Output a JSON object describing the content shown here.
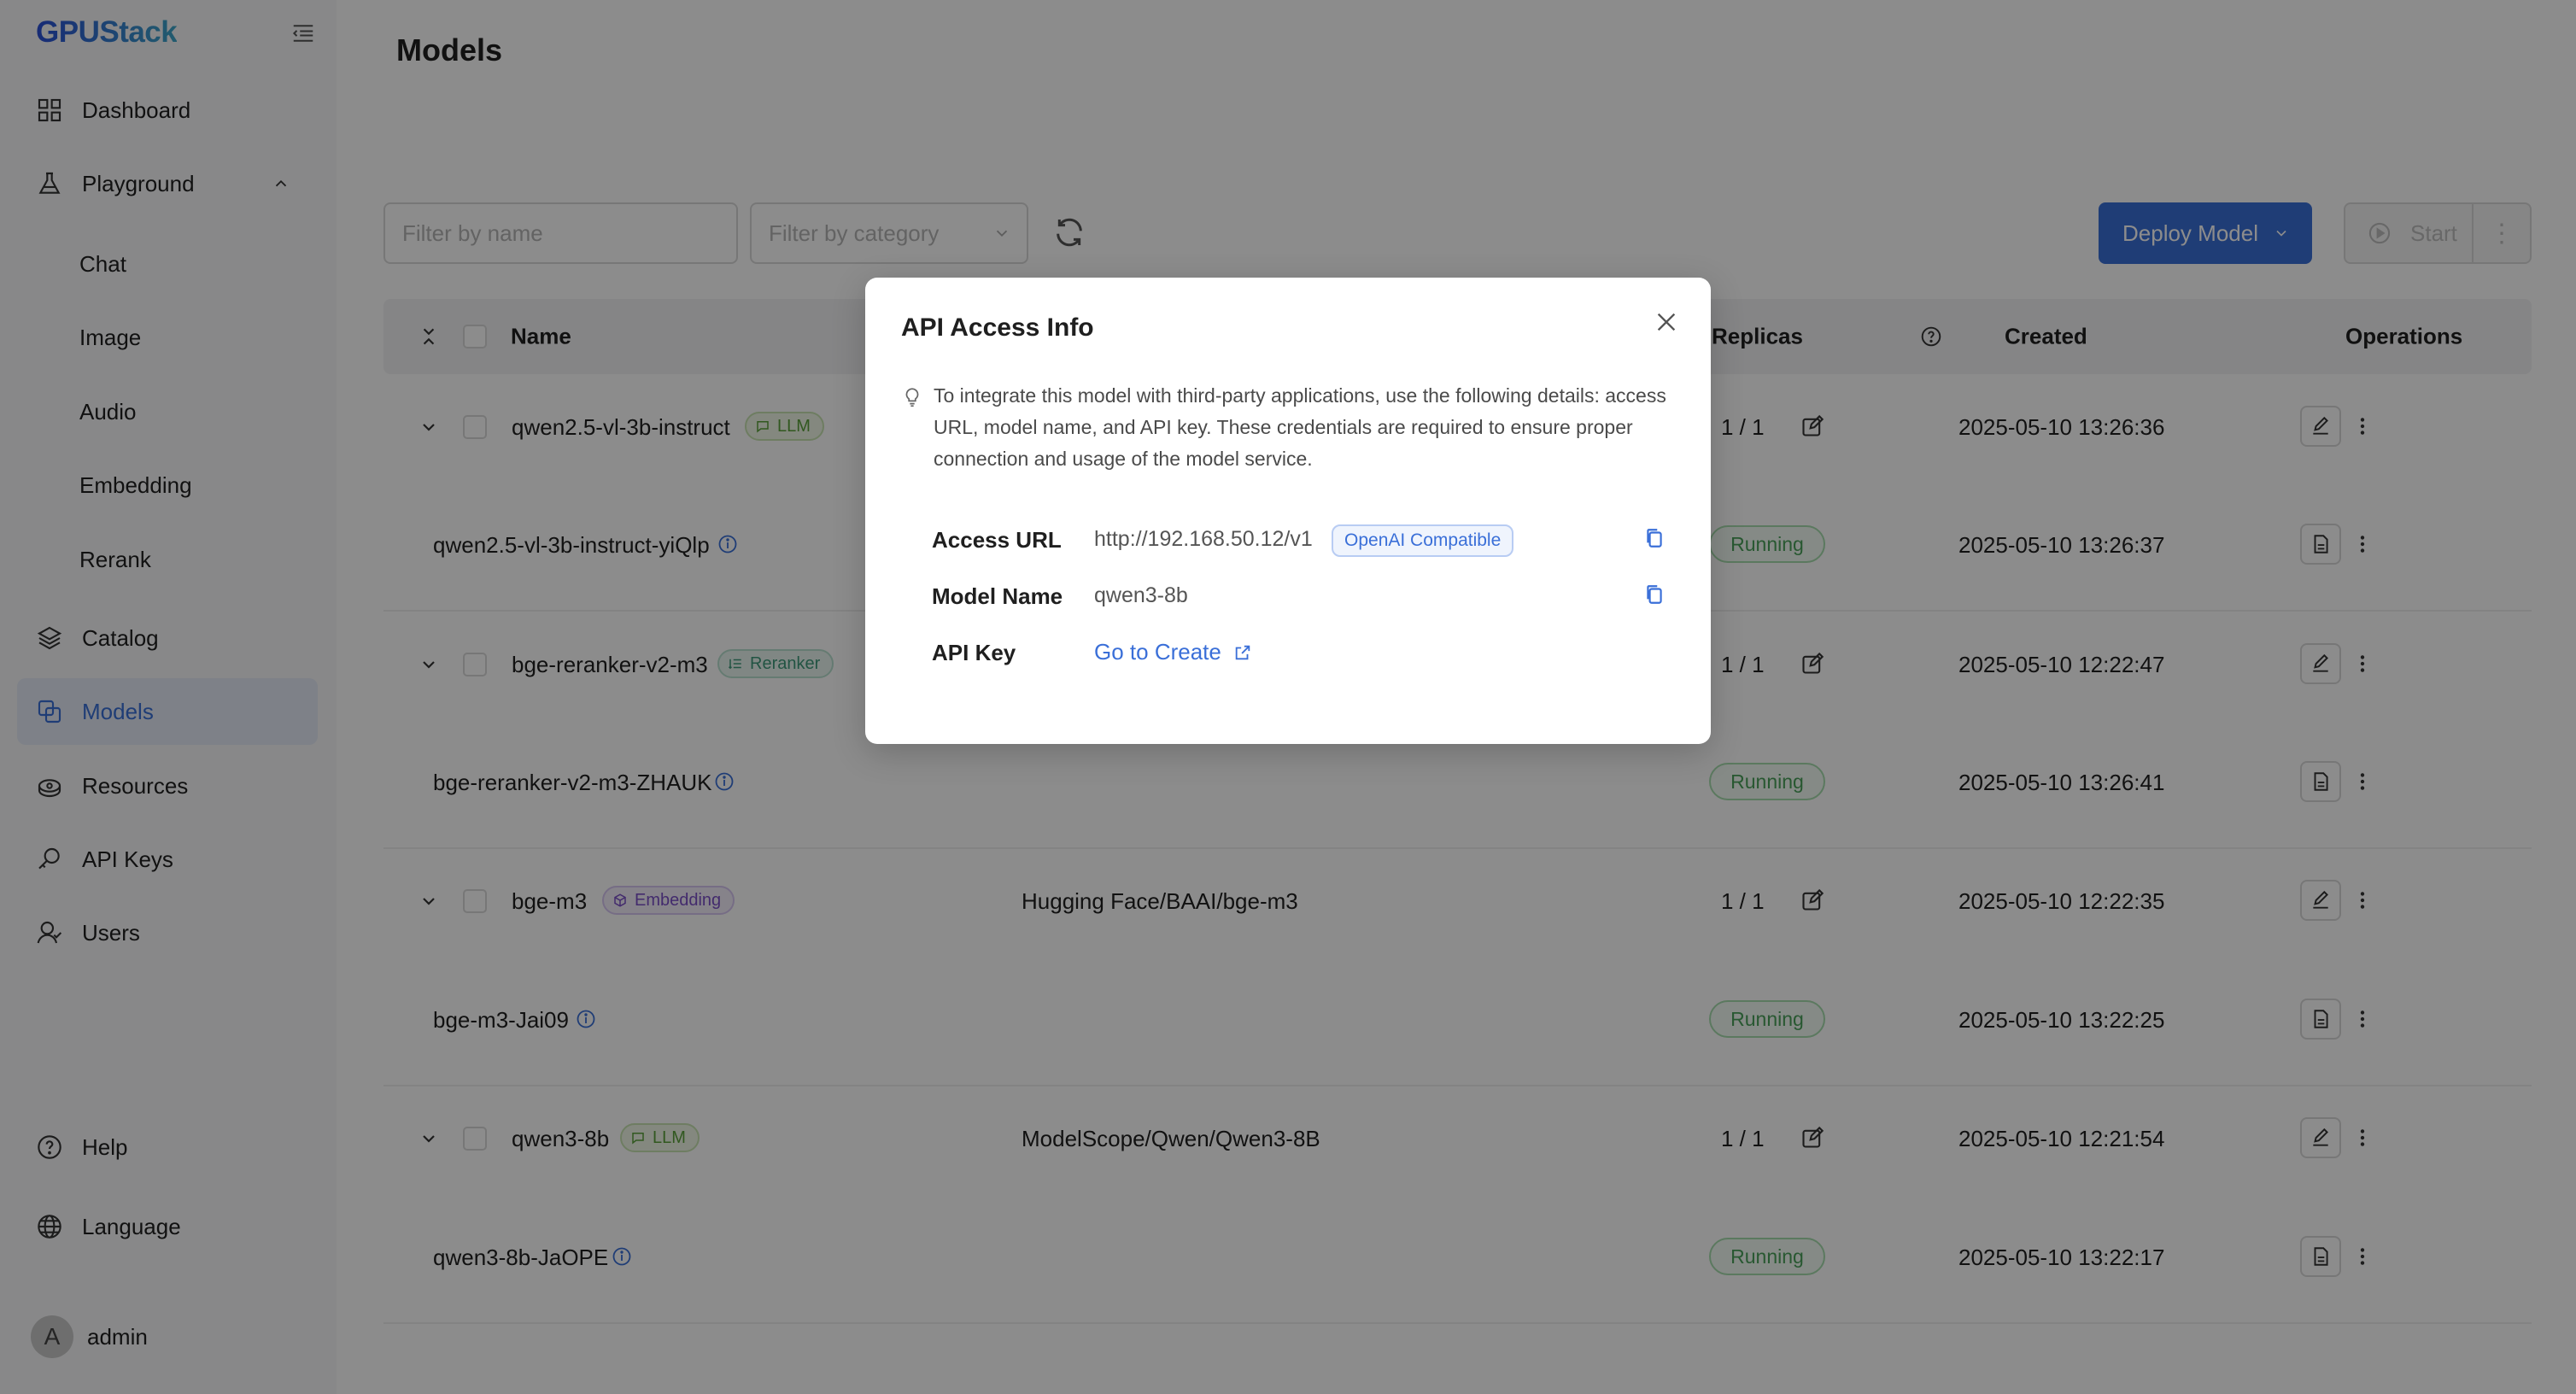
{
  "app": {
    "logo": "GPUStack"
  },
  "sidebar": {
    "items": [
      {
        "label": "Dashboard",
        "icon": "dashboard-icon"
      },
      {
        "label": "Playground",
        "icon": "flask-icon"
      },
      {
        "label": "Catalog",
        "icon": "layers-icon"
      },
      {
        "label": "Models",
        "icon": "models-icon"
      },
      {
        "label": "Resources",
        "icon": "resources-icon"
      },
      {
        "label": "API Keys",
        "icon": "key-icon"
      },
      {
        "label": "Users",
        "icon": "users-icon"
      }
    ],
    "playground_sub": [
      "Chat",
      "Image",
      "Audio",
      "Embedding",
      "Rerank"
    ],
    "bottom": [
      {
        "label": "Help",
        "icon": "help-icon"
      },
      {
        "label": "Language",
        "icon": "globe-icon"
      }
    ],
    "user": {
      "initial": "A",
      "name": "admin"
    }
  },
  "page": {
    "title": "Models"
  },
  "toolbar": {
    "filter_name_placeholder": "Filter by name",
    "filter_category_placeholder": "Filter by category",
    "deploy_label": "Deploy Model",
    "start_label": "Start",
    "more_label": "⋮"
  },
  "table": {
    "columns": {
      "name": "Name",
      "replicas": "Replicas",
      "created": "Created",
      "operations": "Operations"
    },
    "models": [
      {
        "name": "qwen2.5-vl-3b-instruct",
        "tag": "LLM",
        "source": "",
        "replicas": "1 / 1",
        "created": "2025-05-10 13:26:36",
        "instance": {
          "name": "qwen2.5-vl-3b-instruct-yiQlp",
          "status": "Running",
          "created": "2025-05-10 13:26:37"
        }
      },
      {
        "name": "bge-reranker-v2-m3",
        "tag": "Reranker",
        "source": "",
        "replicas": "1 / 1",
        "created": "2025-05-10 12:22:47",
        "instance": {
          "name": "bge-reranker-v2-m3-ZHAUK",
          "status": "Running",
          "created": "2025-05-10 13:26:41"
        }
      },
      {
        "name": "bge-m3",
        "tag": "Embedding",
        "source": "Hugging Face/BAAI/bge-m3",
        "replicas": "1 / 1",
        "created": "2025-05-10 12:22:35",
        "instance": {
          "name": "bge-m3-Jai09",
          "status": "Running",
          "created": "2025-05-10 13:22:25"
        }
      },
      {
        "name": "qwen3-8b",
        "tag": "LLM",
        "source": "ModelScope/Qwen/Qwen3-8B",
        "replicas": "1 / 1",
        "created": "2025-05-10 12:21:54",
        "instance": {
          "name": "qwen3-8b-JaOPE",
          "status": "Running",
          "created": "2025-05-10 13:22:17"
        }
      }
    ]
  },
  "modal": {
    "title": "API Access Info",
    "tip": "To integrate this model with third-party applications, use the following details: access URL, model name, and API key. These credentials are required to ensure proper connection and usage of the model service.",
    "access_url_label": "Access URL",
    "access_url": "http://192.168.50.12/v1",
    "compat_badge": "OpenAI Compatible",
    "model_name_label": "Model Name",
    "model_name": "qwen3-8b",
    "api_key_label": "API Key",
    "api_key_link": "Go to Create"
  },
  "colors": {
    "accent": "#3a6fd8",
    "running": "#4aa05a",
    "overlay": "rgba(0,0,0,0.45)"
  }
}
